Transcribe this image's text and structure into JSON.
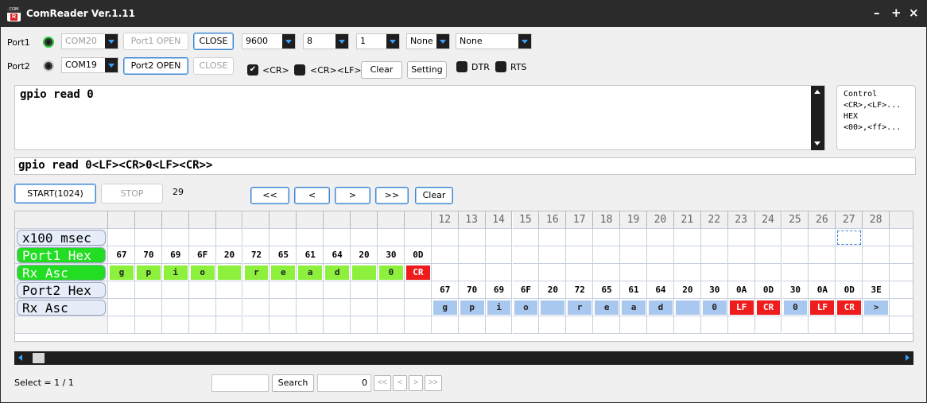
{
  "window": {
    "title": "ComReader Ver.1.11",
    "icon_top": "COM",
    "icon_letter": "R",
    "min": "–",
    "max": "+",
    "close": "×"
  },
  "port1": {
    "label": "Port1",
    "com": "COM20",
    "open": "Port1 OPEN",
    "close": "CLOSE"
  },
  "port2": {
    "label": "Port2",
    "com": "COM19",
    "open": "Port2 OPEN",
    "close": "CLOSE"
  },
  "settings": {
    "baud": "9600",
    "databits": "8",
    "stopbits": "1",
    "parity": "None",
    "flow": "None"
  },
  "options": {
    "cr_label": "<CR>",
    "crlf_label": "<CR><LF>",
    "cr_checked": "✔",
    "clear": "Clear",
    "setting": "Setting",
    "dtr": "DTR",
    "rts": "RTS"
  },
  "send_text": "gpio read 0",
  "control_help": [
    "Control",
    "<CR>,<LF>...",
    "HEX",
    "<00>,<ff>..."
  ],
  "recv_text": "gpio read 0<LF><CR>0<LF><CR>>",
  "controls": {
    "start": "START(1024)",
    "stop": "STOP",
    "count": "29",
    "first": "<<",
    "prev": "<",
    "next": ">",
    "last": ">>",
    "clear": "Clear"
  },
  "grid": {
    "headers": [
      "",
      "",
      "",
      "",
      "",
      "",
      "",
      "",
      "",
      "",
      "",
      "",
      "12",
      "13",
      "14",
      "15",
      "16",
      "17",
      "18",
      "19",
      "20",
      "21",
      "22",
      "23",
      "24",
      "25",
      "26",
      "27",
      "28",
      ""
    ],
    "row_labels": [
      "x100 msec",
      "Port1 Hex",
      "Rx    Asc",
      "Port2 Hex",
      "Rx    Asc"
    ],
    "port1_hex": [
      "67",
      "70",
      "69",
      "6F",
      "20",
      "72",
      "65",
      "61",
      "64",
      "20",
      "30",
      "0D"
    ],
    "port1_asc": [
      "g",
      "p",
      "i",
      "o",
      "",
      "r",
      "e",
      "a",
      "d",
      "",
      "0",
      "CR"
    ],
    "port2_hex": [
      "67",
      "70",
      "69",
      "6F",
      "20",
      "72",
      "65",
      "61",
      "64",
      "20",
      "30",
      "0A",
      "0D",
      "30",
      "0A",
      "0D",
      "3E"
    ],
    "port2_asc": [
      "g",
      "p",
      "i",
      "o",
      "",
      "r",
      "e",
      "a",
      "d",
      "",
      "0",
      "LF",
      "CR",
      "0",
      "LF",
      "CR",
      ">"
    ],
    "colors": {
      "port1_cell": "#8cf03c",
      "port1_label": "#22dd22",
      "port2_cell": "#a9c8f0",
      "control_cell": "#ee1c1c",
      "port2_label": "#e6ecf8"
    }
  },
  "footer": {
    "select": "Select = 1 / 1",
    "search": "Search",
    "index": "0",
    "first": "<<",
    "prev": "<",
    "next": ">",
    "last": ">>"
  }
}
